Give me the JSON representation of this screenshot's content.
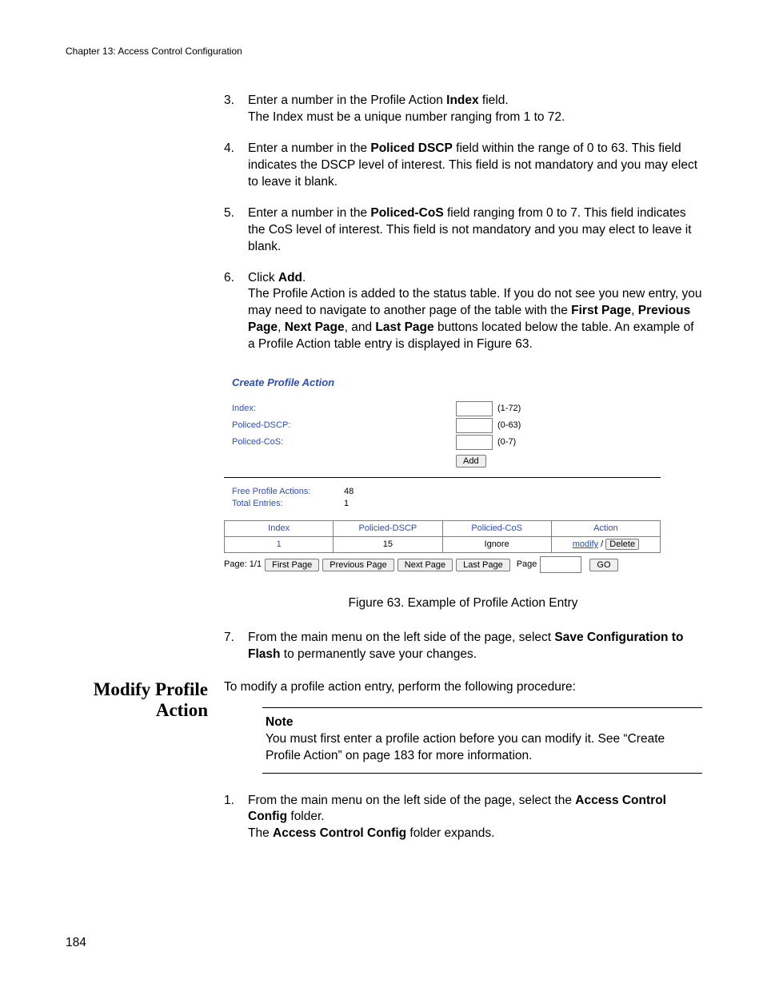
{
  "header": {
    "chapter": "Chapter 13: Access Control Configuration"
  },
  "steps1": {
    "s3": {
      "num": "3.",
      "t1a": "Enter a number in the Profile Action ",
      "t1b": "Index",
      "t1c": " field.",
      "t2": "The Index must be a unique number ranging from 1 to 72."
    },
    "s4": {
      "num": "4.",
      "t1a": "Enter a number in the ",
      "t1b": "Policed DSCP",
      "t1c": " field within the range of 0 to 63. This field indicates the DSCP level of interest. This field is not mandatory and you may elect to leave it blank."
    },
    "s5": {
      "num": "5.",
      "t1a": "Enter a number in the ",
      "t1b": "Policed-CoS",
      "t1c": " field ranging from 0 to 7. This field indicates the CoS level of interest. This field is not mandatory and you may elect to leave it blank."
    },
    "s6": {
      "num": "6.",
      "t1a": "Click ",
      "t1b": "Add",
      "t1c": ".",
      "t2a": "The Profile Action is added to the status table. If you do not see you new entry, you may need to navigate to another page of the table with the ",
      "t2b": "First Page",
      "t2c": ", ",
      "t2d": "Previous Page",
      "t2e": ", ",
      "t2f": "Next Page",
      "t2g": ", and ",
      "t2h": "Last Page",
      "t2i": " buttons located below the table. An example of a Profile Action table entry is displayed in Figure 63."
    }
  },
  "figure": {
    "title": "Create Profile Action",
    "row1": {
      "label": "Index:",
      "range": "(1-72)"
    },
    "row2": {
      "label": "Policed-DSCP:",
      "range": "(0-63)"
    },
    "row3": {
      "label": "Policed-CoS:",
      "range": "(0-7)"
    },
    "add": "Add",
    "stat1": {
      "label": "Free Profile Actions:",
      "val": "48"
    },
    "stat2": {
      "label": "Total Entries:",
      "val": "1"
    },
    "table": {
      "h1": "Index",
      "h2": "Policied-DSCP",
      "h3": "Policied-CoS",
      "h4": "Action",
      "r1c1": "1",
      "r1c2": "15",
      "r1c3": "Ignore",
      "modify": "modify",
      "sep": " / ",
      "delete": "Delete"
    },
    "pager": {
      "page_lbl": "Page: 1/1",
      "first": "First Page",
      "prev": "Previous Page",
      "next": "Next Page",
      "last": "Last Page",
      "page_word": "Page",
      "go": "GO"
    },
    "caption": "Figure 63. Example of Profile Action Entry"
  },
  "steps2": {
    "s7": {
      "num": "7.",
      "t1a": "From the main menu on the left side of the page, select ",
      "t1b": "Save Configuration to Flash",
      "t1c": " to permanently save your changes."
    }
  },
  "modify": {
    "heading_a": "Modify Profile",
    "heading_b": "Action",
    "intro": "To modify a profile action entry, perform the following procedure:",
    "note_label": "Note",
    "note_body": "You must first enter a profile action before you can modify it. See “Create Profile Action” on page 183 for more information.",
    "s1": {
      "num": "1.",
      "t1a": "From the main menu on the left side of the page, select the ",
      "t1b": "Access Control Config",
      "t1c": " folder.",
      "t2a": "The ",
      "t2b": "Access Control Config",
      "t2c": " folder expands."
    }
  },
  "page_number": "184"
}
